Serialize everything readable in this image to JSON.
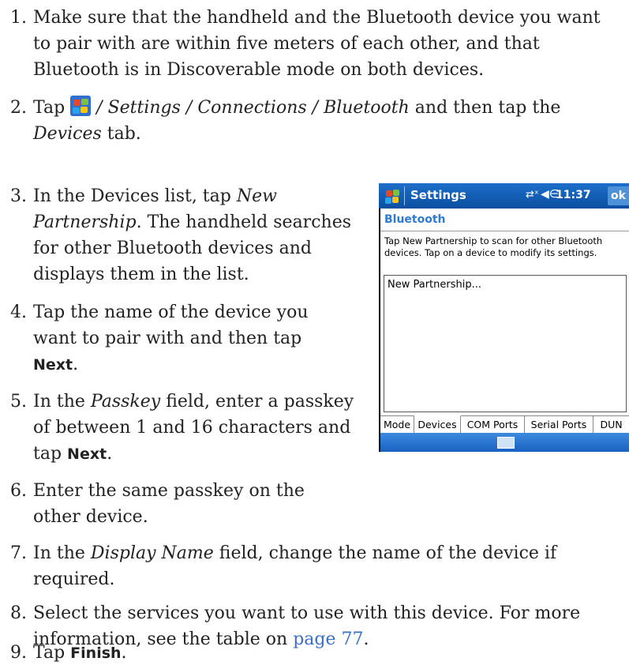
{
  "steps": [
    {
      "num": "1.",
      "lines": [
        "Make sure that the handheld and the Bluetooth device you want",
        "to pair with are within five meters of each other, and that",
        "Bluetooth is in Discoverable mode on both devices."
      ]
    },
    {
      "num": "2.",
      "tap": "Tap",
      "path": "/ Settings / Connections / Bluetooth",
      "after": "and then tap the",
      "tab_name": "Devices",
      "tab_suffix": "tab."
    },
    {
      "num": "3.",
      "l1_pre": "In the Devices list, tap",
      "l1_it": "New",
      "l2_it": "Partnership",
      "l2_post": ". The handheld searches",
      "l3": "for other Bluetooth devices and",
      "l4": "displays them in the list."
    },
    {
      "num": "4.",
      "l1": "Tap the name of the device you",
      "l2": "want to pair with and then tap",
      "btn": "Next",
      "end": "."
    },
    {
      "num": "5.",
      "l1_pre": "In the",
      "field": "Passkey",
      "l1_post": "field, enter a passkey",
      "l2": "of between 1 and 16 characters and",
      "l3_pre": "tap",
      "btn": "Next",
      "end": "."
    },
    {
      "num": "6.",
      "l1": "Enter the same passkey on the",
      "l2": "other device."
    },
    {
      "num": "7.",
      "l1_pre": "In the",
      "field": "Display Name",
      "l1_post": "field, change the name of the device if",
      "l2": "required."
    },
    {
      "num": "8.",
      "l1": "Select the services you want to use with this device. For more",
      "l2_pre": "information, see the table on",
      "link": "page 77",
      "end": "."
    },
    {
      "num": "9.",
      "pre": "Tap",
      "btn": "Finish",
      "end": "."
    }
  ],
  "device": {
    "title": "Settings",
    "status_conn": "⇄ˣ",
    "status_speaker": "◀∈",
    "clock": "11:37",
    "ok": "ok",
    "heading": "Bluetooth",
    "instructions": "Tap New Partnership to scan for other Bluetooth devices. Tap on a device to modify its settings.",
    "list_items": [
      "New Partnership..."
    ],
    "tabs": [
      "Mode",
      "Devices",
      "COM Ports",
      "Serial Ports",
      "DUN"
    ],
    "active_tab": "Devices"
  }
}
